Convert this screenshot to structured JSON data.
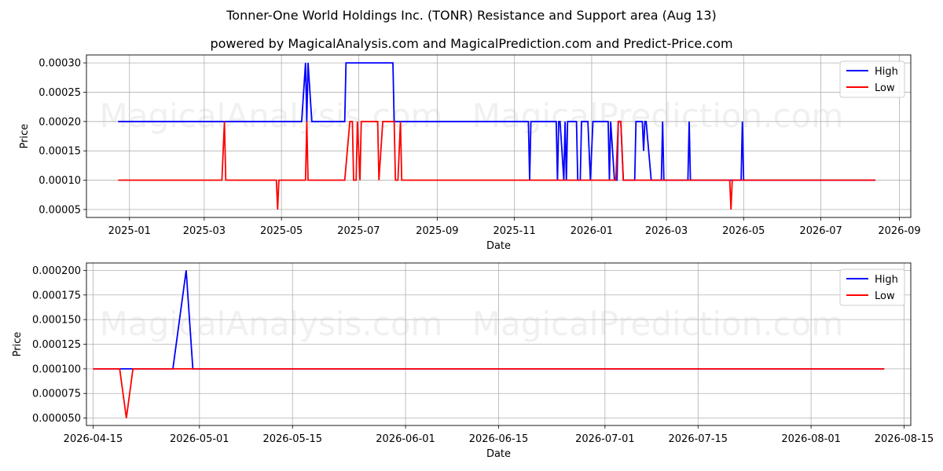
{
  "titles": {
    "main": "Tonner-One World Holdings Inc. (TONR) Resistance and Support area (Aug 13)",
    "sub": "powered by MagicalAnalysis.com and MagicalPrediction.com and Predict-Price.com"
  },
  "watermarks": [
    "MagicalAnalysis.com",
    "MagicalPrediction.com"
  ],
  "colors": {
    "high": "#0000ff",
    "low": "#ff0000",
    "grid": "#b0b0b0"
  },
  "chart_data": [
    {
      "type": "line",
      "xlabel": "Date",
      "ylabel": "Price",
      "x_ticks": [
        "2025-01",
        "2025-03",
        "2025-05",
        "2025-07",
        "2025-09",
        "2025-11",
        "2026-01",
        "2026-03",
        "2026-05",
        "2026-07",
        "2026-09"
      ],
      "y_ticks": [
        "0.00005",
        "0.00010",
        "0.00015",
        "0.00020",
        "0.00025",
        "0.00030"
      ],
      "xlim": [
        "2024-11-28",
        "2026-09-10"
      ],
      "ylim": [
        3.65e-05,
        0.0003135
      ],
      "legend": {
        "position": "top-right",
        "entries": [
          "High",
          "Low"
        ]
      },
      "grid": true,
      "series": [
        {
          "name": "High",
          "points": [
            [
              "2024-12-23",
              0.0002
            ],
            [
              "2025-05-17",
              0.0002
            ],
            [
              "2025-05-20",
              0.0003
            ],
            [
              "2025-05-21",
              0.0002
            ],
            [
              "2025-05-22",
              0.0003
            ],
            [
              "2025-05-25",
              0.0002
            ],
            [
              "2025-06-20",
              0.0002
            ],
            [
              "2025-06-21",
              0.0003
            ],
            [
              "2025-07-28",
              0.0003
            ],
            [
              "2025-07-29",
              0.0002
            ],
            [
              "2025-11-12",
              0.0002
            ],
            [
              "2025-11-13",
              0.0001
            ],
            [
              "2025-11-14",
              0.0002
            ],
            [
              "2025-12-04",
              0.0002
            ],
            [
              "2025-12-05",
              0.0001
            ],
            [
              "2025-12-06",
              0.0002
            ],
            [
              "2025-12-07",
              0.0002
            ],
            [
              "2025-12-10",
              0.0001
            ],
            [
              "2025-12-11",
              0.0002
            ],
            [
              "2025-12-12",
              0.0001
            ],
            [
              "2025-12-13",
              0.0002
            ],
            [
              "2025-12-20",
              0.0002
            ],
            [
              "2025-12-21",
              0.0001
            ],
            [
              "2025-12-23",
              0.0001
            ],
            [
              "2025-12-24",
              0.0002
            ],
            [
              "2025-12-29",
              0.0002
            ],
            [
              "2025-12-31",
              0.0001
            ],
            [
              "2026-01-02",
              0.0002
            ],
            [
              "2026-01-14",
              0.0002
            ],
            [
              "2026-01-15",
              0.0001
            ],
            [
              "2026-01-16",
              0.0002
            ],
            [
              "2026-01-19",
              0.0001
            ],
            [
              "2026-01-21",
              0.0001
            ],
            [
              "2026-01-22",
              0.0002
            ],
            [
              "2026-01-24",
              0.0002
            ],
            [
              "2026-01-26",
              0.0001
            ],
            [
              "2026-02-04",
              0.0001
            ],
            [
              "2026-02-05",
              0.0002
            ],
            [
              "2026-02-10",
              0.0002
            ],
            [
              "2026-02-11",
              0.00015
            ],
            [
              "2026-02-12",
              0.0002
            ],
            [
              "2026-02-13",
              0.0002
            ],
            [
              "2026-02-17",
              0.0001
            ],
            [
              "2026-02-25",
              0.0001
            ],
            [
              "2026-02-26",
              0.0002
            ],
            [
              "2026-02-27",
              0.0001
            ],
            [
              "2026-03-18",
              0.0001
            ],
            [
              "2026-03-19",
              0.0002
            ],
            [
              "2026-03-20",
              0.0001
            ],
            [
              "2026-04-29",
              0.0001
            ],
            [
              "2026-04-30",
              0.0002
            ],
            [
              "2026-05-01",
              0.0001
            ],
            [
              "2026-08-13",
              0.0001
            ]
          ]
        },
        {
          "name": "Low",
          "points": [
            [
              "2024-12-23",
              0.0001
            ],
            [
              "2025-03-15",
              0.0001
            ],
            [
              "2025-03-17",
              0.0002
            ],
            [
              "2025-03-18",
              0.0001
            ],
            [
              "2025-04-27",
              0.0001
            ],
            [
              "2025-04-28",
              5e-05
            ],
            [
              "2025-04-29",
              0.0001
            ],
            [
              "2025-05-20",
              0.0001
            ],
            [
              "2025-05-21",
              0.0002
            ],
            [
              "2025-05-22",
              0.0001
            ],
            [
              "2025-06-20",
              0.0001
            ],
            [
              "2025-06-24",
              0.0002
            ],
            [
              "2025-06-26",
              0.0002
            ],
            [
              "2025-06-27",
              0.0001
            ],
            [
              "2025-06-29",
              0.0001
            ],
            [
              "2025-06-30",
              0.0002
            ],
            [
              "2025-07-02",
              0.0001
            ],
            [
              "2025-07-03",
              0.0002
            ],
            [
              "2025-07-16",
              0.0002
            ],
            [
              "2025-07-17",
              0.0001
            ],
            [
              "2025-07-20",
              0.0002
            ],
            [
              "2025-07-29",
              0.0002
            ],
            [
              "2025-07-30",
              0.0001
            ],
            [
              "2025-08-01",
              0.0001
            ],
            [
              "2025-08-03",
              0.0002
            ],
            [
              "2025-08-04",
              0.0001
            ],
            [
              "2026-01-20",
              0.0001
            ],
            [
              "2026-01-22",
              0.0002
            ],
            [
              "2026-01-24",
              0.0002
            ],
            [
              "2026-01-26",
              0.0001
            ],
            [
              "2026-04-20",
              0.0001
            ],
            [
              "2026-04-21",
              5e-05
            ],
            [
              "2026-04-22",
              0.0001
            ],
            [
              "2026-08-13",
              0.0001
            ]
          ]
        }
      ]
    },
    {
      "type": "line",
      "xlabel": "Date",
      "ylabel": "Price",
      "x_ticks": [
        "2026-04-15",
        "2026-05-01",
        "2026-05-15",
        "2026-06-01",
        "2026-06-15",
        "2026-07-01",
        "2026-07-15",
        "2026-08-01",
        "2026-08-15"
      ],
      "y_ticks": [
        "0.000050",
        "0.000075",
        "0.000100",
        "0.000125",
        "0.000150",
        "0.000175",
        "0.000200"
      ],
      "xlim": [
        "2026-04-14",
        "2026-08-16"
      ],
      "ylim": [
        4.25e-05,
        0.0002075
      ],
      "legend": {
        "position": "top-right",
        "entries": [
          "High",
          "Low"
        ]
      },
      "grid": true,
      "series": [
        {
          "name": "High",
          "points": [
            [
              "2026-04-15",
              0.0001
            ],
            [
              "2026-04-27",
              0.0001
            ],
            [
              "2026-04-29",
              0.0002
            ],
            [
              "2026-04-30",
              0.0001
            ],
            [
              "2026-08-12",
              0.0001
            ]
          ]
        },
        {
          "name": "Low",
          "points": [
            [
              "2026-04-15",
              0.0001
            ],
            [
              "2026-04-19",
              0.0001
            ],
            [
              "2026-04-20",
              5e-05
            ],
            [
              "2026-04-21",
              0.0001
            ],
            [
              "2026-08-12",
              0.0001
            ]
          ]
        }
      ]
    }
  ]
}
